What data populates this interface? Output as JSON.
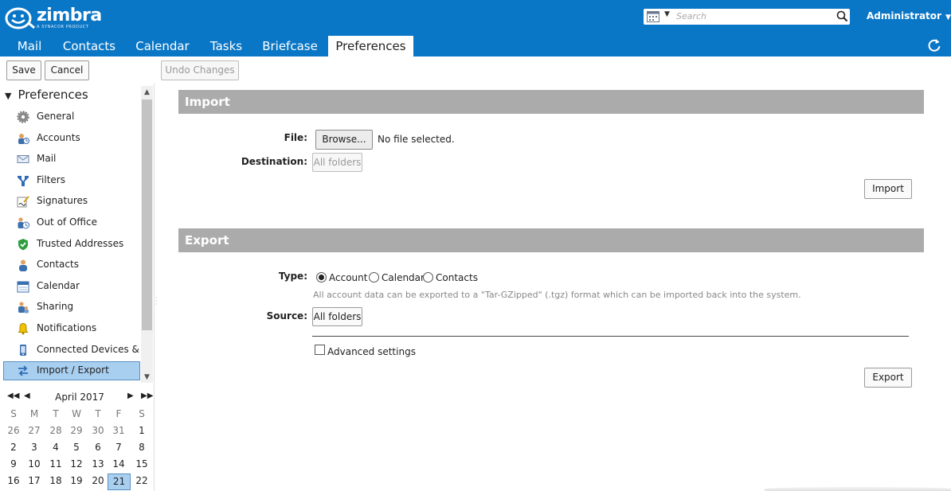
{
  "header": {
    "brand": "zimbra",
    "brand_tagline": "A SYNACOR PRODUCT",
    "search_placeholder": "Search",
    "user": "Administrator"
  },
  "nav": {
    "tabs": [
      {
        "label": "Mail"
      },
      {
        "label": "Contacts"
      },
      {
        "label": "Calendar"
      },
      {
        "label": "Tasks"
      },
      {
        "label": "Briefcase"
      },
      {
        "label": "Preferences",
        "active": true
      }
    ]
  },
  "toolbar": {
    "save_label": "Save",
    "cancel_label": "Cancel",
    "undo_label": "Undo Changes"
  },
  "sidebar": {
    "header": "Preferences",
    "items": [
      {
        "label": "General",
        "icon": "gear-icon"
      },
      {
        "label": "Accounts",
        "icon": "accounts-icon"
      },
      {
        "label": "Mail",
        "icon": "envelope-icon"
      },
      {
        "label": "Filters",
        "icon": "filter-icon"
      },
      {
        "label": "Signatures",
        "icon": "signature-icon"
      },
      {
        "label": "Out of Office",
        "icon": "out-of-office-icon"
      },
      {
        "label": "Trusted Addresses",
        "icon": "shield-check-icon"
      },
      {
        "label": "Contacts",
        "icon": "contact-icon"
      },
      {
        "label": "Calendar",
        "icon": "calendar-icon"
      },
      {
        "label": "Sharing",
        "icon": "sharing-icon"
      },
      {
        "label": "Notifications",
        "icon": "bell-icon"
      },
      {
        "label": "Connected Devices & Ap",
        "icon": "mobile-device-icon"
      },
      {
        "label": "Import / Export",
        "icon": "import-export-icon",
        "selected": true
      }
    ]
  },
  "minical": {
    "title": "April 2017",
    "weekdays": [
      "S",
      "M",
      "T",
      "W",
      "T",
      "F",
      "S"
    ],
    "weeks": [
      [
        "26",
        "27",
        "28",
        "29",
        "30",
        "31",
        "1"
      ],
      [
        "2",
        "3",
        "4",
        "5",
        "6",
        "7",
        "8"
      ],
      [
        "9",
        "10",
        "11",
        "12",
        "13",
        "14",
        "15"
      ],
      [
        "16",
        "17",
        "18",
        "19",
        "20",
        "21",
        "22"
      ]
    ],
    "today": "21"
  },
  "import": {
    "title": "Import",
    "file_label": "File:",
    "browse_label": "Browse...",
    "no_file_text": "No file selected.",
    "destination_label": "Destination:",
    "destination_value": "All folders",
    "import_button": "Import"
  },
  "export": {
    "title": "Export",
    "type_label": "Type:",
    "types": [
      {
        "label": "Account",
        "checked": true
      },
      {
        "label": "Calendar",
        "checked": false
      },
      {
        "label": "Contacts",
        "checked": false
      }
    ],
    "hint": "All account data can be exported to a \"Tar-GZipped\" (.tgz) format which can be imported back into the system.",
    "source_label": "Source:",
    "source_value": "All folders",
    "advanced_label": "Advanced settings",
    "export_button": "Export"
  }
}
